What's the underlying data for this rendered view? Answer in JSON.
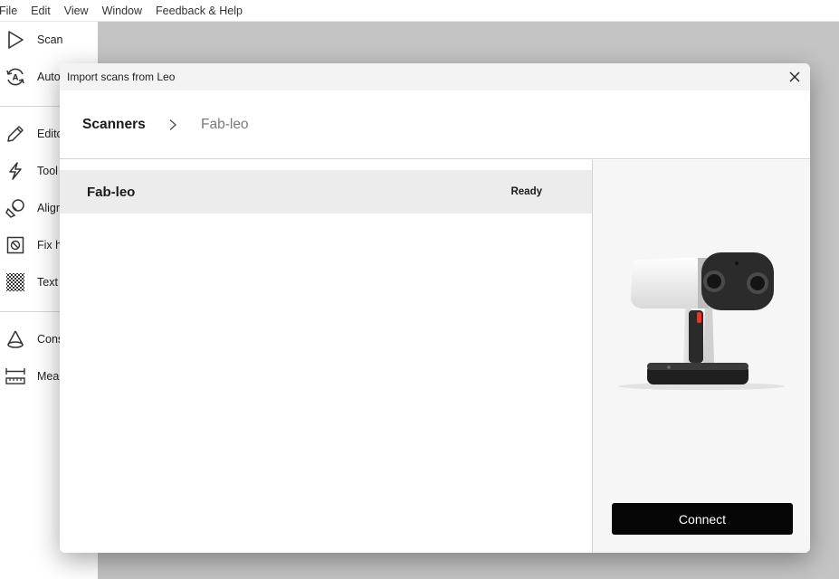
{
  "menubar": {
    "items": [
      "File",
      "Edit",
      "View",
      "Window",
      "Feedback & Help"
    ]
  },
  "sidebar": {
    "items": [
      {
        "label": "Scan",
        "icon": "play-icon"
      },
      {
        "label": "Auto",
        "icon": "auto-icon"
      },
      {
        "label": "Edito",
        "icon": "pencil-icon"
      },
      {
        "label": "Tool",
        "icon": "lightning-icon"
      },
      {
        "label": "Align",
        "icon": "align-icon"
      },
      {
        "label": "Fix h",
        "icon": "fix-holes-icon"
      },
      {
        "label": "Text",
        "icon": "texture-icon"
      },
      {
        "label": "Cons",
        "icon": "cone-icon"
      },
      {
        "label": "Mea",
        "icon": "ruler-icon"
      }
    ]
  },
  "dialog": {
    "title": "Import scans from Leo",
    "breadcrumb": {
      "root": "Scanners",
      "current": "Fab-leo"
    },
    "scanners": [
      {
        "name": "Fab-leo",
        "status": "Ready"
      }
    ],
    "connect_label": "Connect"
  },
  "colors": {
    "workspace": "#c4c4c4",
    "selected_row": "#ececec",
    "connect_button": "#050505",
    "scanner_accent": "#e3382b"
  }
}
